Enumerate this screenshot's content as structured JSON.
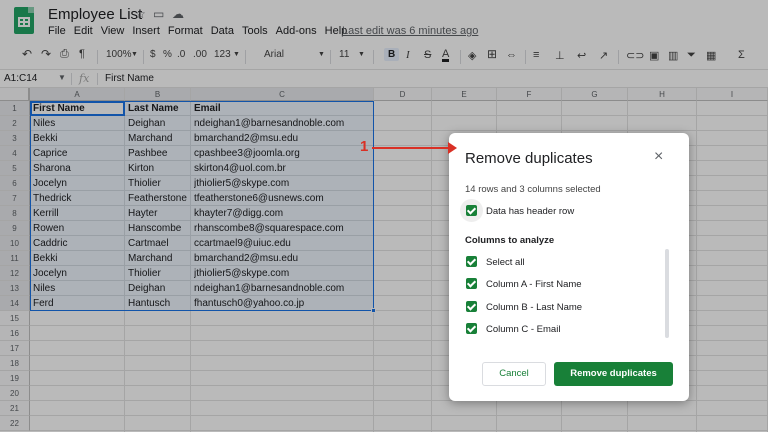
{
  "app": {
    "doc_title": "Employee List",
    "menu": [
      "File",
      "Edit",
      "View",
      "Insert",
      "Format",
      "Data",
      "Tools",
      "Add-ons",
      "Help"
    ],
    "last_edit": "Last edit was 6 minutes ago"
  },
  "toolbar": {
    "zoom": "100%",
    "currency": "$",
    "percent": "%",
    "decimal_less": ".0",
    "decimal_more": ".00",
    "more_formats": "123",
    "font": "Arial",
    "font_size": "11",
    "bold": "B",
    "italic": "I",
    "strikethrough": "S",
    "text_color": "A",
    "sigma": "Σ"
  },
  "formula_bar": {
    "name_box": "A1:C14",
    "fx": "fx",
    "value": "First Name"
  },
  "sheet": {
    "columns": [
      "A",
      "B",
      "C",
      "D",
      "E",
      "F",
      "G",
      "H",
      "I"
    ],
    "rows": [
      "1",
      "2",
      "3",
      "4",
      "5",
      "6",
      "7",
      "8",
      "9",
      "10",
      "11",
      "12",
      "13",
      "14",
      "15",
      "16",
      "17",
      "18",
      "19",
      "20",
      "21",
      "22"
    ],
    "header": [
      "First Name",
      "Last Name",
      "Email"
    ],
    "data": [
      [
        "Niles",
        "Deighan",
        "ndeighan1@barnesandnoble.com"
      ],
      [
        "Bekki",
        "Marchand",
        "bmarchand2@msu.edu"
      ],
      [
        "Caprice",
        "Pashbee",
        "cpashbee3@joomla.org"
      ],
      [
        "Sharona",
        "Kirton",
        "skirton4@uol.com.br"
      ],
      [
        "Jocelyn",
        "Thiolier",
        "jthiolier5@skype.com"
      ],
      [
        "Thedrick",
        "Featherstone",
        "tfeatherstone6@usnews.com"
      ],
      [
        "Kerrill",
        "Hayter",
        "khayter7@digg.com"
      ],
      [
        "Rowen",
        "Hanscombe",
        "rhanscombe8@squarespace.com"
      ],
      [
        "Caddric",
        "Cartmael",
        "ccartmael9@uiuc.edu"
      ],
      [
        "Bekki",
        "Marchand",
        "bmarchand2@msu.edu"
      ],
      [
        "Jocelyn",
        "Thiolier",
        "jthiolier5@skype.com"
      ],
      [
        "Niles",
        "Deighan",
        "ndeighan1@barnesandnoble.com"
      ],
      [
        "Ferd",
        "Hantusch",
        "fhantusch0@yahoo.co.jp"
      ]
    ]
  },
  "dialog": {
    "title": "Remove duplicates",
    "close": "×",
    "selected_info": "14 rows and 3 columns selected",
    "header_row_label": "Data has header row",
    "columns_title": "Columns to analyze",
    "options": [
      "Select all",
      "Column A - First Name",
      "Column B - Last Name",
      "Column C - Email"
    ],
    "cancel_label": "Cancel",
    "remove_label": "Remove duplicates"
  },
  "annotation": {
    "number": "1"
  },
  "colors": {
    "accent_green": "#188038",
    "selection_blue": "#1a73e8",
    "annotation_red": "#d93025"
  }
}
